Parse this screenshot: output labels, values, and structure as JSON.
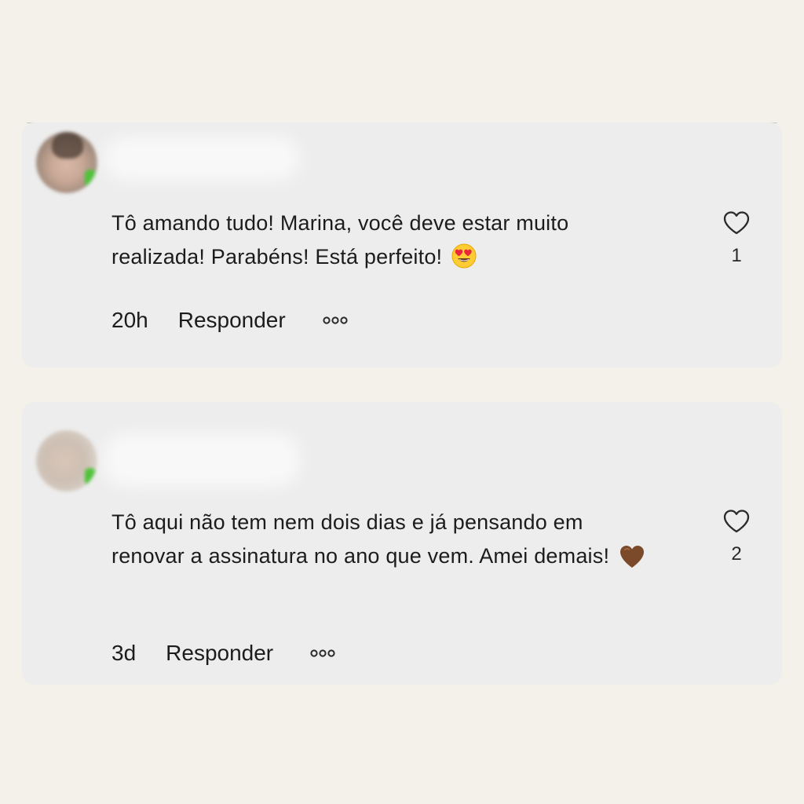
{
  "comments": [
    {
      "text": "Tô amando tudo! Marina, você deve estar muito realizada! Parabéns! Está perfeito!",
      "emoji": "heart-eyes-emoji",
      "likes": "1",
      "time": "20h",
      "reply_label": "Responder"
    },
    {
      "text": "Tô aqui não tem nem dois dias e já pensando em renovar a assinatura no ano que vem. Amei demais!",
      "emoji": "brown-heart-emoji",
      "likes": "2",
      "time": "3d",
      "reply_label": "Responder"
    }
  ],
  "colors": {
    "page_background": "#f4f0ea",
    "card_background": "#ededed",
    "text": "#1c1c1c",
    "online_badge": "#4fc23a",
    "brown_heart": "#7b4a2a"
  },
  "icons": {
    "like": "heart-outline-icon",
    "more": "three-dots-icon"
  }
}
